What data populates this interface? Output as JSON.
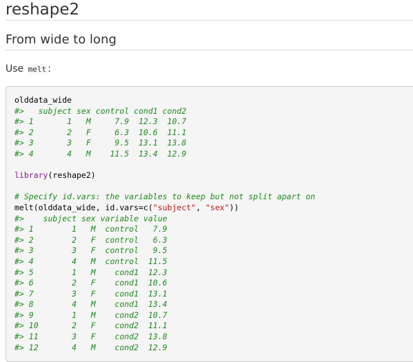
{
  "heading": "reshape2",
  "subheading": "From wide to long",
  "intro": {
    "prefix": "Use ",
    "code": "melt",
    "suffix": ":"
  },
  "code": {
    "l01": "olddata_wide",
    "l02": "#>   subject sex control cond1 cond2",
    "l03": "#> 1       1   M     7.9  12.3  10.7",
    "l04": "#> 2       2   F     6.3  10.6  11.1",
    "l05": "#> 3       3   F     9.5  13.1  13.8",
    "l06": "#> 4       4   M    11.5  13.4  12.9",
    "l08_fn": "library",
    "l08_args": "(reshape2)",
    "l10": "# Specify id.vars: the variables to keep but not split apart on",
    "l11_a": "melt(olddata_wide, id.vars=c(",
    "l11_s1": "\"subject\"",
    "l11_b": ", ",
    "l11_s2": "\"sex\"",
    "l11_c": "))",
    "l12": "#>    subject sex variable value",
    "l13": "#> 1        1   M  control   7.9",
    "l14": "#> 2        2   F  control   6.3",
    "l15": "#> 3        3   F  control   9.5",
    "l16": "#> 4        4   M  control  11.5",
    "l17": "#> 5        1   M    cond1  12.3",
    "l18": "#> 6        2   F    cond1  10.6",
    "l19": "#> 7        3   F    cond1  13.1",
    "l20": "#> 8        4   M    cond1  13.4",
    "l21": "#> 9        1   M    cond2  10.7",
    "l22": "#> 10       2   F    cond2  11.1",
    "l23": "#> 11       3   F    cond2  13.8",
    "l24": "#> 12       4   M    cond2  12.9"
  }
}
